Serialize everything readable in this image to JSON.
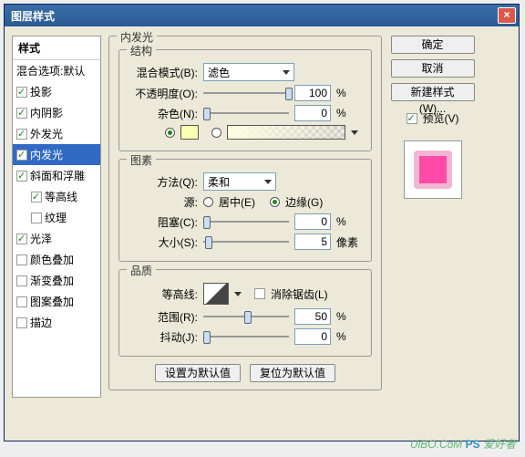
{
  "title": "图层样式",
  "styles": {
    "header": "样式",
    "blend_default": "混合选项:默认",
    "items": [
      {
        "label": "投影",
        "checked": true
      },
      {
        "label": "内阴影",
        "checked": true
      },
      {
        "label": "外发光",
        "checked": true
      },
      {
        "label": "内发光",
        "checked": true,
        "selected": true
      },
      {
        "label": "斜面和浮雕",
        "checked": true
      },
      {
        "label": "等高线",
        "checked": true,
        "indent": true
      },
      {
        "label": "纹理",
        "checked": false,
        "indent": true
      },
      {
        "label": "光泽",
        "checked": true
      },
      {
        "label": "颜色叠加",
        "checked": false
      },
      {
        "label": "渐变叠加",
        "checked": false
      },
      {
        "label": "图案叠加",
        "checked": false
      },
      {
        "label": "描边",
        "checked": false
      }
    ]
  },
  "panel_title": "内发光",
  "structure": {
    "title": "结构",
    "blend_mode_lbl": "混合模式(B):",
    "blend_mode_val": "滤色",
    "opacity_lbl": "不透明度(O):",
    "opacity_val": "100",
    "opacity_unit": "%",
    "noise_lbl": "杂色(N):",
    "noise_val": "0",
    "noise_unit": "%",
    "swatch_color": "#fcffb0"
  },
  "elements": {
    "title": "图素",
    "technique_lbl": "方法(Q):",
    "technique_val": "柔和",
    "source_lbl": "源:",
    "center": "居中(E)",
    "edge": "边缘(G)",
    "choke_lbl": "阻塞(C):",
    "choke_val": "0",
    "choke_unit": "%",
    "size_lbl": "大小(S):",
    "size_val": "5",
    "size_unit": "像素"
  },
  "quality": {
    "title": "品质",
    "contour_lbl": "等高线:",
    "antialias": "消除锯齿(L)",
    "range_lbl": "范围(R):",
    "range_val": "50",
    "range_unit": "%",
    "jitter_lbl": "抖动(J):",
    "jitter_val": "0",
    "jitter_unit": "%"
  },
  "buttons": {
    "ok": "确定",
    "cancel": "取消",
    "newstyle": "新建样式(W)...",
    "preview": "预览(V)",
    "setdefault": "设置为默认值",
    "resetdefault": "复位为默认值"
  },
  "watermark": {
    "a": "UiBO.CoM",
    "b": "PS",
    "c": "爱好者"
  }
}
